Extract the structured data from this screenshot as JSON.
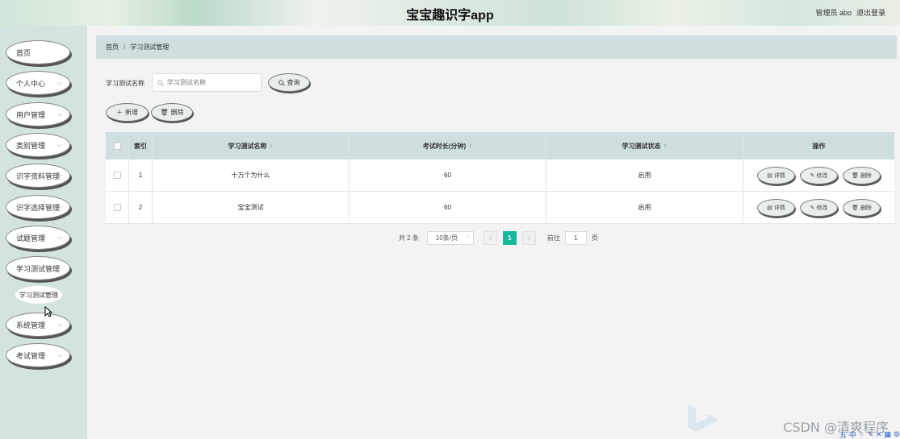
{
  "header": {
    "title": "宝宝趣识字app",
    "user_label": "管理员 abo",
    "logout_label": "退出登录"
  },
  "sidebar": {
    "items": [
      {
        "label": "首页",
        "has_arrow": false
      },
      {
        "label": "个人中心",
        "has_arrow": true
      },
      {
        "label": "用户管理",
        "has_arrow": true
      },
      {
        "label": "类别管理",
        "has_arrow": true
      },
      {
        "label": "识字资料管理",
        "has_arrow": true
      },
      {
        "label": "识字选择管理",
        "has_arrow": true
      },
      {
        "label": "试题管理",
        "has_arrow": true
      },
      {
        "label": "学习测试管理",
        "has_arrow": false
      },
      {
        "label": "系统管理",
        "has_arrow": true
      },
      {
        "label": "考试管理",
        "has_arrow": true
      }
    ],
    "sub_item": "学习测试管理"
  },
  "breadcrumb": {
    "home": "首页",
    "separator": "/",
    "current": "学习测试管理"
  },
  "search": {
    "label": "学习测试名称",
    "placeholder": "学习测试名称",
    "button": "查询"
  },
  "actions": {
    "add": "新增",
    "delete": "删除"
  },
  "table": {
    "headers": {
      "index": "索引",
      "name": "学习测试名称",
      "duration": "考试时长(分钟)",
      "status": "学习测试状态",
      "ops": "操作"
    },
    "rows": [
      {
        "index": "1",
        "name": "十万个为什么",
        "duration": "60",
        "status": "启用"
      },
      {
        "index": "2",
        "name": "宝宝测试",
        "duration": "60",
        "status": "启用"
      }
    ],
    "row_actions": {
      "detail": "详情",
      "edit": "修改",
      "delete": "删除"
    }
  },
  "pagination": {
    "total_text": "共 2 条",
    "page_size": "10条/页",
    "current_page": "1",
    "goto_label": "前往",
    "goto_value": "1",
    "page_suffix": "页"
  },
  "watermark": "CSDN @清爽程序",
  "colors": {
    "accent": "#16b89a",
    "sidebar_bg": "#d3e3e0",
    "table_header_bg": "#cfdfdf"
  }
}
